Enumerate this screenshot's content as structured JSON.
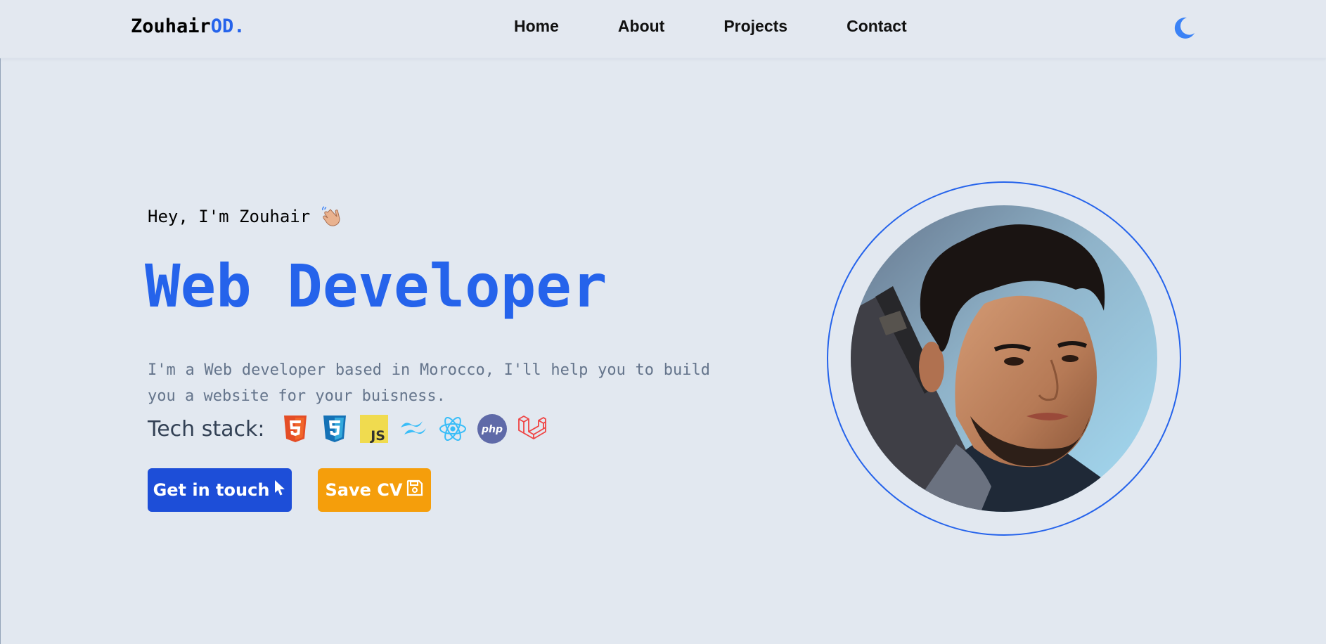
{
  "header": {
    "logo_main": "Zouhair",
    "logo_accent": "OD.",
    "nav": [
      "Home",
      "About",
      "Projects",
      "Contact"
    ],
    "theme_toggle_icon": "moon-icon"
  },
  "hero": {
    "greeting": "Hey, I'm Zouhair",
    "greeting_icon": "waving-hand-icon",
    "headline": "Web Developer",
    "bio": "I'm a Web developer based in Morocco, I'll help you to build you a website for your buisness.",
    "tech_label": "Tech stack:",
    "tech_icons": [
      "html5-icon",
      "css3-icon",
      "javascript-icon",
      "tailwind-icon",
      "react-icon",
      "php-icon",
      "laravel-icon"
    ],
    "tech_icon_labels": {
      "javascript": "JS",
      "php": "php"
    },
    "buttons": {
      "contact": {
        "label": "Get in touch",
        "icon": "cursor-icon"
      },
      "cv": {
        "label": "Save CV",
        "icon": "floppy-disk-icon"
      }
    },
    "portrait": "profile-portrait"
  },
  "colors": {
    "background": "#e2e8f0",
    "accent": "#2563eb",
    "contact_button": "#1d4ed8",
    "cv_button": "#f59e0b",
    "muted_text": "#64748b"
  }
}
